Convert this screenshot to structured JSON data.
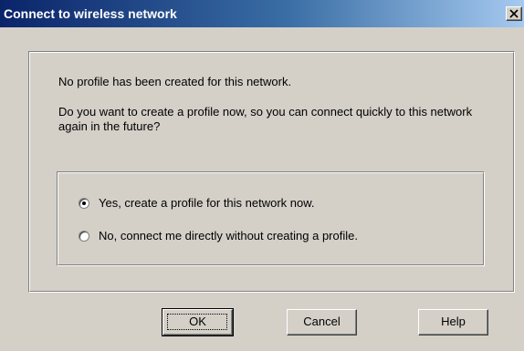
{
  "window": {
    "title": "Connect to wireless network",
    "close_glyph": "✕"
  },
  "message": {
    "line1": "No profile has been created for this network.",
    "line2": "Do you want to create a profile now, so you can connect quickly to this network again in the future?"
  },
  "options": [
    {
      "label": "Yes, create a profile for this network now.",
      "selected": true
    },
    {
      "label": "No, connect me directly without creating a profile.",
      "selected": false
    }
  ],
  "buttons": {
    "ok": "OK",
    "cancel": "Cancel",
    "help": "Help"
  },
  "colors": {
    "title_bar_start": "#0a246a",
    "title_bar_end": "#a6caf0",
    "face": "#d4d0c8"
  }
}
